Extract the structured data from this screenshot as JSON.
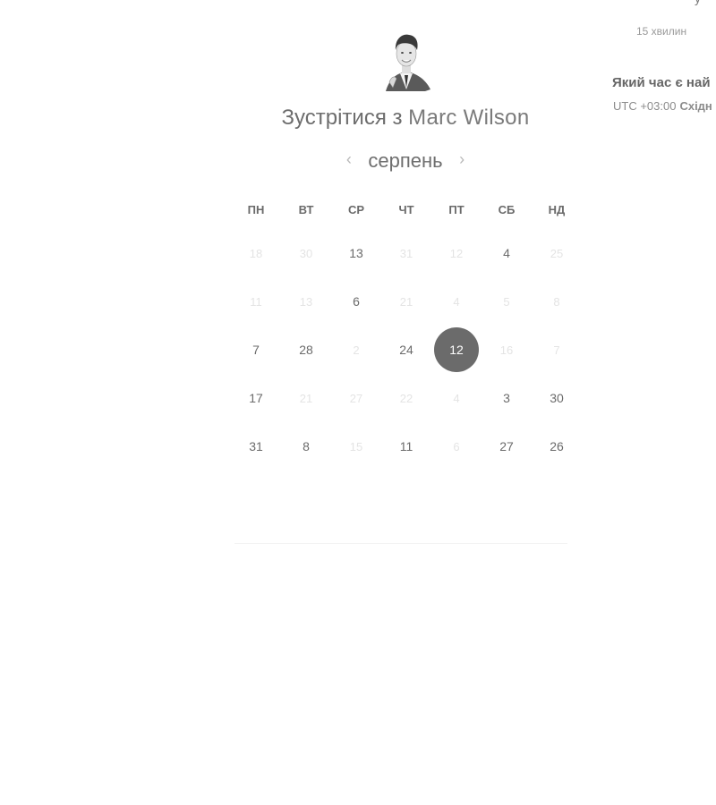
{
  "side_panel": {
    "top_fragment": "y",
    "duration": "15 хвилин",
    "question": "Який час є най",
    "timezone_offset": "UTC +03:00",
    "timezone_name": "Східн"
  },
  "header": {
    "heading_prefix": "Зустрітися з ",
    "host_name": "Marc Wilson"
  },
  "month_nav": {
    "prev_icon": "‹",
    "month": "серпень",
    "next_icon": "›"
  },
  "calendar": {
    "weekdays": [
      "ПН",
      "ВТ",
      "СР",
      "ЧТ",
      "ПТ",
      "СБ",
      "НД"
    ],
    "weeks": [
      [
        {
          "label": "18",
          "state": "disabled"
        },
        {
          "label": "30",
          "state": "disabled"
        },
        {
          "label": "13",
          "state": "available"
        },
        {
          "label": "31",
          "state": "disabled"
        },
        {
          "label": "12",
          "state": "disabled"
        },
        {
          "label": "4",
          "state": "available"
        },
        {
          "label": "25",
          "state": "disabled"
        }
      ],
      [
        {
          "label": "11",
          "state": "disabled"
        },
        {
          "label": "13",
          "state": "disabled"
        },
        {
          "label": "6",
          "state": "available"
        },
        {
          "label": "21",
          "state": "disabled"
        },
        {
          "label": "4",
          "state": "disabled"
        },
        {
          "label": "5",
          "state": "disabled"
        },
        {
          "label": "8",
          "state": "disabled"
        }
      ],
      [
        {
          "label": "7",
          "state": "available"
        },
        {
          "label": "28",
          "state": "available"
        },
        {
          "label": "2",
          "state": "disabled"
        },
        {
          "label": "24",
          "state": "available"
        },
        {
          "label": "12",
          "state": "selected"
        },
        {
          "label": "16",
          "state": "disabled"
        },
        {
          "label": "7",
          "state": "disabled"
        }
      ],
      [
        {
          "label": "17",
          "state": "available"
        },
        {
          "label": "21",
          "state": "disabled"
        },
        {
          "label": "27",
          "state": "disabled"
        },
        {
          "label": "22",
          "state": "disabled"
        },
        {
          "label": "4",
          "state": "disabled"
        },
        {
          "label": "3",
          "state": "available"
        },
        {
          "label": "30",
          "state": "available"
        }
      ],
      [
        {
          "label": "31",
          "state": "available"
        },
        {
          "label": "8",
          "state": "available"
        },
        {
          "label": "15",
          "state": "disabled"
        },
        {
          "label": "11",
          "state": "available"
        },
        {
          "label": "6",
          "state": "disabled"
        },
        {
          "label": "27",
          "state": "available"
        },
        {
          "label": "26",
          "state": "available"
        }
      ]
    ]
  },
  "colors": {
    "selected_day_bg": "#6b6b6b",
    "text": "#6b6b6b",
    "disabled_text": "#e4e4e4"
  }
}
